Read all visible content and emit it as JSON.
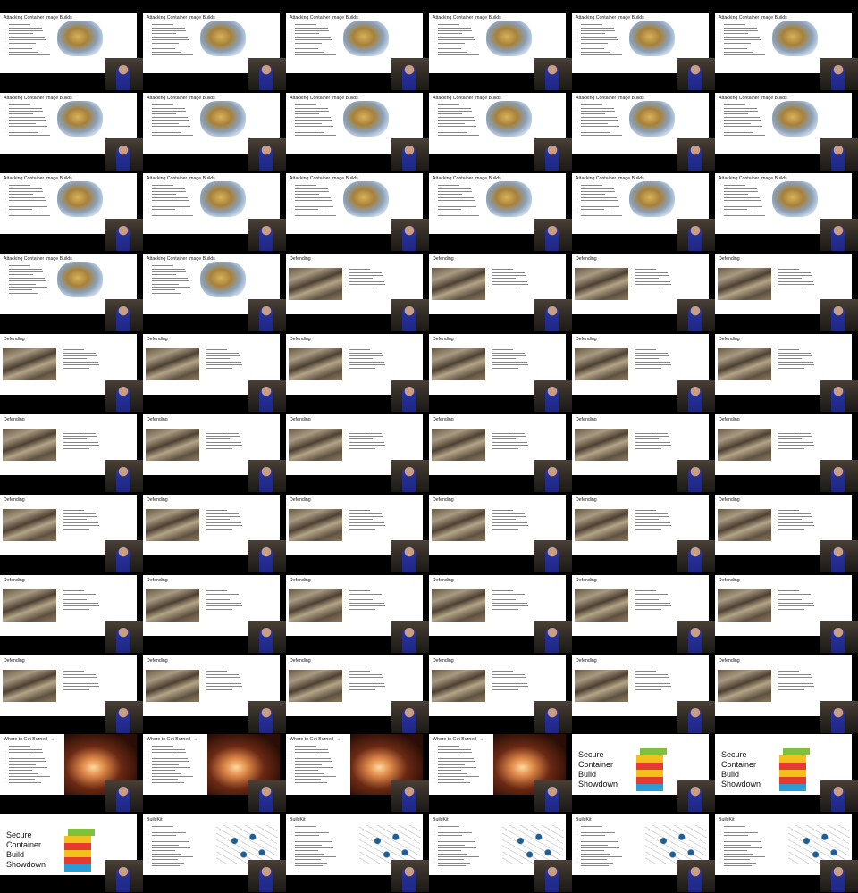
{
  "thumbnails": [
    {
      "type": "bullet",
      "title": "Attacking Container Image Builds"
    },
    {
      "type": "bullet",
      "title": "Attacking Container Image Builds"
    },
    {
      "type": "bullet",
      "title": "Attacking Container Image Builds"
    },
    {
      "type": "bullet",
      "title": "Attacking Container Image Builds"
    },
    {
      "type": "bullet",
      "title": "Attacking Container Image Builds"
    },
    {
      "type": "bullet",
      "title": "Attacking Container Image Builds"
    },
    {
      "type": "bullet",
      "title": "Attacking Container Image Builds"
    },
    {
      "type": "bullet",
      "title": "Attacking Container Image Builds"
    },
    {
      "type": "bullet",
      "title": "Attacking Container Image Builds"
    },
    {
      "type": "bullet",
      "title": "Attacking Container Image Builds"
    },
    {
      "type": "bullet",
      "title": "Attacking Container Image Builds"
    },
    {
      "type": "bullet",
      "title": "Attacking Container Image Builds"
    },
    {
      "type": "bullet",
      "title": "Attacking Container Image Builds"
    },
    {
      "type": "bullet",
      "title": "Attacking Container Image Builds"
    },
    {
      "type": "bullet",
      "title": "Attacking Container Image Builds"
    },
    {
      "type": "bullet",
      "title": "Attacking Container Image Builds"
    },
    {
      "type": "bullet",
      "title": "Attacking Container Image Builds"
    },
    {
      "type": "bullet",
      "title": "Attacking Container Image Builds"
    },
    {
      "type": "bullet",
      "title": "Attacking Container Image Builds"
    },
    {
      "type": "bullet",
      "title": "Attacking Container Image Builds"
    },
    {
      "type": "defend",
      "title": "Defending"
    },
    {
      "type": "defend",
      "title": "Defending"
    },
    {
      "type": "defend",
      "title": "Defending"
    },
    {
      "type": "defend",
      "title": "Defending"
    },
    {
      "type": "defend",
      "title": "Defending"
    },
    {
      "type": "defend",
      "title": "Defending"
    },
    {
      "type": "defend",
      "title": "Defending"
    },
    {
      "type": "defend",
      "title": "Defending"
    },
    {
      "type": "defend",
      "title": "Defending"
    },
    {
      "type": "defend",
      "title": "Defending"
    },
    {
      "type": "defend",
      "title": "Defending"
    },
    {
      "type": "defend",
      "title": "Defending"
    },
    {
      "type": "defend",
      "title": "Defending"
    },
    {
      "type": "defend",
      "title": "Defending"
    },
    {
      "type": "defend",
      "title": "Defending"
    },
    {
      "type": "defend",
      "title": "Defending"
    },
    {
      "type": "defend",
      "title": "Defending"
    },
    {
      "type": "defend",
      "title": "Defending"
    },
    {
      "type": "defend",
      "title": "Defending"
    },
    {
      "type": "defend",
      "title": "Defending"
    },
    {
      "type": "defend",
      "title": "Defending"
    },
    {
      "type": "defend",
      "title": "Defending"
    },
    {
      "type": "defend",
      "title": "Defending"
    },
    {
      "type": "defend",
      "title": "Defending"
    },
    {
      "type": "defend",
      "title": "Defending"
    },
    {
      "type": "defend",
      "title": "Defending"
    },
    {
      "type": "defend",
      "title": "Defending"
    },
    {
      "type": "defend",
      "title": "Defending"
    },
    {
      "type": "defend",
      "title": "Defending"
    },
    {
      "type": "defend",
      "title": "Defending"
    },
    {
      "type": "defend",
      "title": "Defending"
    },
    {
      "type": "defend",
      "title": "Defending"
    },
    {
      "type": "defend",
      "title": "Defending"
    },
    {
      "type": "defend",
      "title": "Defending"
    },
    {
      "type": "fire",
      "title": "Where to Get Burned"
    },
    {
      "type": "fire",
      "title": "Where to Get Burned"
    },
    {
      "type": "fire",
      "title": "Where to Get Burned"
    },
    {
      "type": "fire",
      "title": "Where to Get Burned"
    },
    {
      "type": "showdown",
      "title_lines": [
        "Secure",
        "Container",
        "Build",
        "Showdown"
      ]
    },
    {
      "type": "showdown",
      "title_lines": [
        "Secure",
        "Container",
        "Build",
        "Showdown"
      ]
    },
    {
      "type": "showdown",
      "title_lines": [
        "Secure",
        "Container",
        "Build",
        "Showdown"
      ]
    },
    {
      "type": "buildkit",
      "title": "BuildKit"
    },
    {
      "type": "buildkit",
      "title": "BuildKit"
    },
    {
      "type": "buildkit",
      "title": "BuildKit"
    },
    {
      "type": "buildkit",
      "title": "BuildKit"
    },
    {
      "type": "buildkit",
      "title": "BuildKit"
    }
  ],
  "colors": {
    "background": "#000000",
    "slide": "#ffffff",
    "link": "#1a62c4"
  }
}
